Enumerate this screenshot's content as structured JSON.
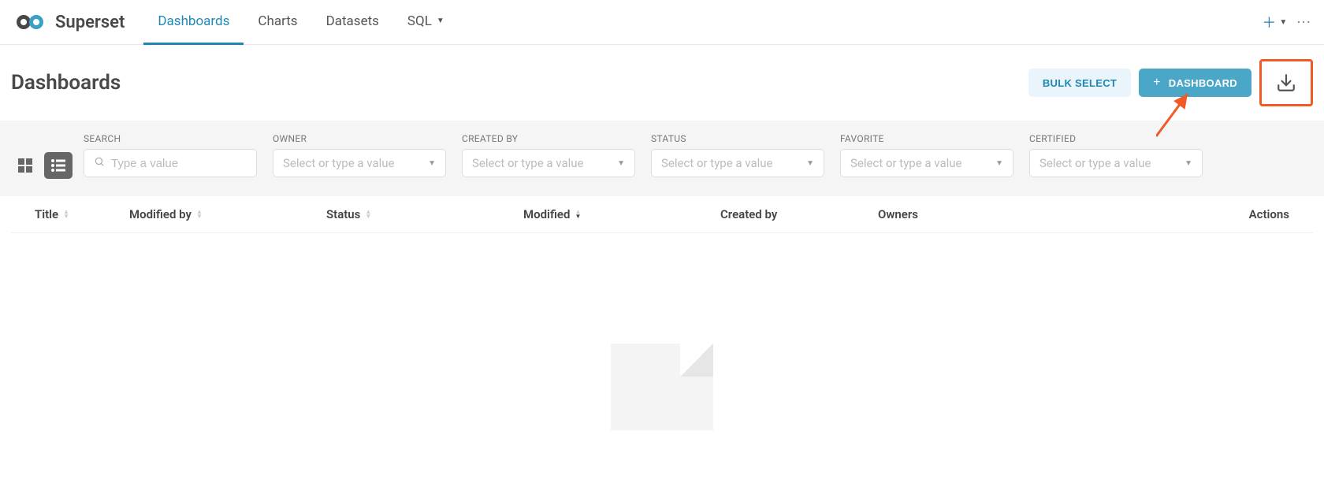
{
  "brand": {
    "name": "Superset"
  },
  "nav": {
    "items": [
      {
        "label": "Dashboards",
        "active": true
      },
      {
        "label": "Charts"
      },
      {
        "label": "Datasets"
      },
      {
        "label": "SQL",
        "dropdown": true
      }
    ]
  },
  "page": {
    "title": "Dashboards"
  },
  "actions": {
    "bulk_select": "BULK SELECT",
    "create": "DASHBOARD"
  },
  "filters": {
    "search": {
      "label": "SEARCH",
      "placeholder": "Type a value"
    },
    "owner": {
      "label": "OWNER",
      "placeholder": "Select or type a value"
    },
    "created": {
      "label": "CREATED BY",
      "placeholder": "Select or type a value"
    },
    "status": {
      "label": "STATUS",
      "placeholder": "Select or type a value"
    },
    "favorite": {
      "label": "FAVORITE",
      "placeholder": "Select or type a value"
    },
    "certified": {
      "label": "CERTIFIED",
      "placeholder": "Select or type a value"
    }
  },
  "table": {
    "columns": {
      "title": "Title",
      "modified_by": "Modified by",
      "status": "Status",
      "modified": "Modified",
      "created_by": "Created by",
      "owners": "Owners",
      "actions": "Actions"
    }
  }
}
